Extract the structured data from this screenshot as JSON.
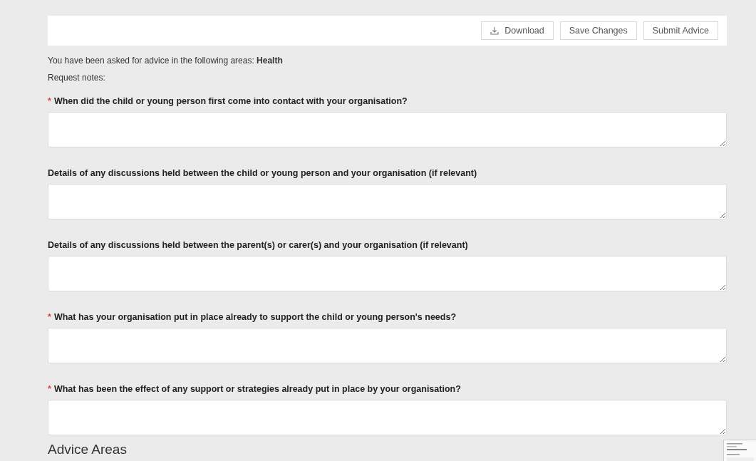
{
  "toolbar": {
    "buttons": [
      {
        "label": "Download",
        "kind": "download"
      },
      {
        "label": "Save Changes"
      },
      {
        "label": "Submit Advice"
      }
    ]
  },
  "intro": "You have been asked for advice in the following areas: **Health**",
  "request_notes_label": "Request notes:",
  "questions": [
    {
      "label": "When did the child or young person first come into contact with your organisation?",
      "required_mark": "*"
    },
    {
      "label": "Details of any discussions held between the child or young person and your organisation (if relevant)"
    },
    {
      "label": "Details of any discussions held between the parent(s) or carer(s) and your organisation (if relevant)"
    },
    {
      "label": "What has your organisation put in place already to support the child or young person's needs?",
      "required_mark": "*"
    },
    {
      "label": "What has been the effect of any support or strategies already put in place by your organisation?",
      "required_mark": "*"
    }
  ],
  "section_heading": "Advice Areas"
}
